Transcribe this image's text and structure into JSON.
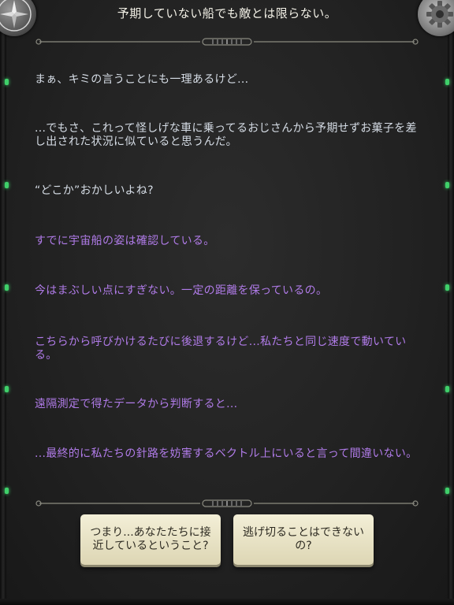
{
  "header": {
    "title": "予期していない船でも敵とは限らない。",
    "compass_icon": "compass-icon",
    "settings_icon": "gear-icon"
  },
  "dialogue": [
    {
      "speaker": "player",
      "text": "まぁ、キミの言うことにも一理あるけど..."
    },
    {
      "speaker": "player",
      "text": "...でもさ、これって怪しげな車に乗ってるおじさんから予期せずお菓子を差し出された状況に似ていると思うんだ。"
    },
    {
      "speaker": "player",
      "text": "“どこか”おかしいよね?"
    },
    {
      "speaker": "ai",
      "text": "すでに宇宙船の姿は確認している。"
    },
    {
      "speaker": "ai",
      "text": "今はまぶしい点にすぎない。一定の距離を保っているの。"
    },
    {
      "speaker": "ai",
      "text": "こちらから呼びかけるたびに後退するけど...私たちと同じ速度で動いている。"
    },
    {
      "speaker": "ai",
      "text": "遠隔測定で得たデータから判断すると..."
    },
    {
      "speaker": "ai",
      "text": "...最終的に私たちの針路を妨害するベクトル上にいると言って間違いない。"
    }
  ],
  "choices": [
    {
      "label": "つまり...あなたたちに接近しているということ?"
    },
    {
      "label": "逃げ切ることはできないの?"
    }
  ],
  "colors": {
    "player_text": "#d6dde6",
    "ai_text": "#b07be8",
    "title_text": "#f2f0e6",
    "choice_bg": "#ede8cc",
    "led": "#3fd06a"
  }
}
